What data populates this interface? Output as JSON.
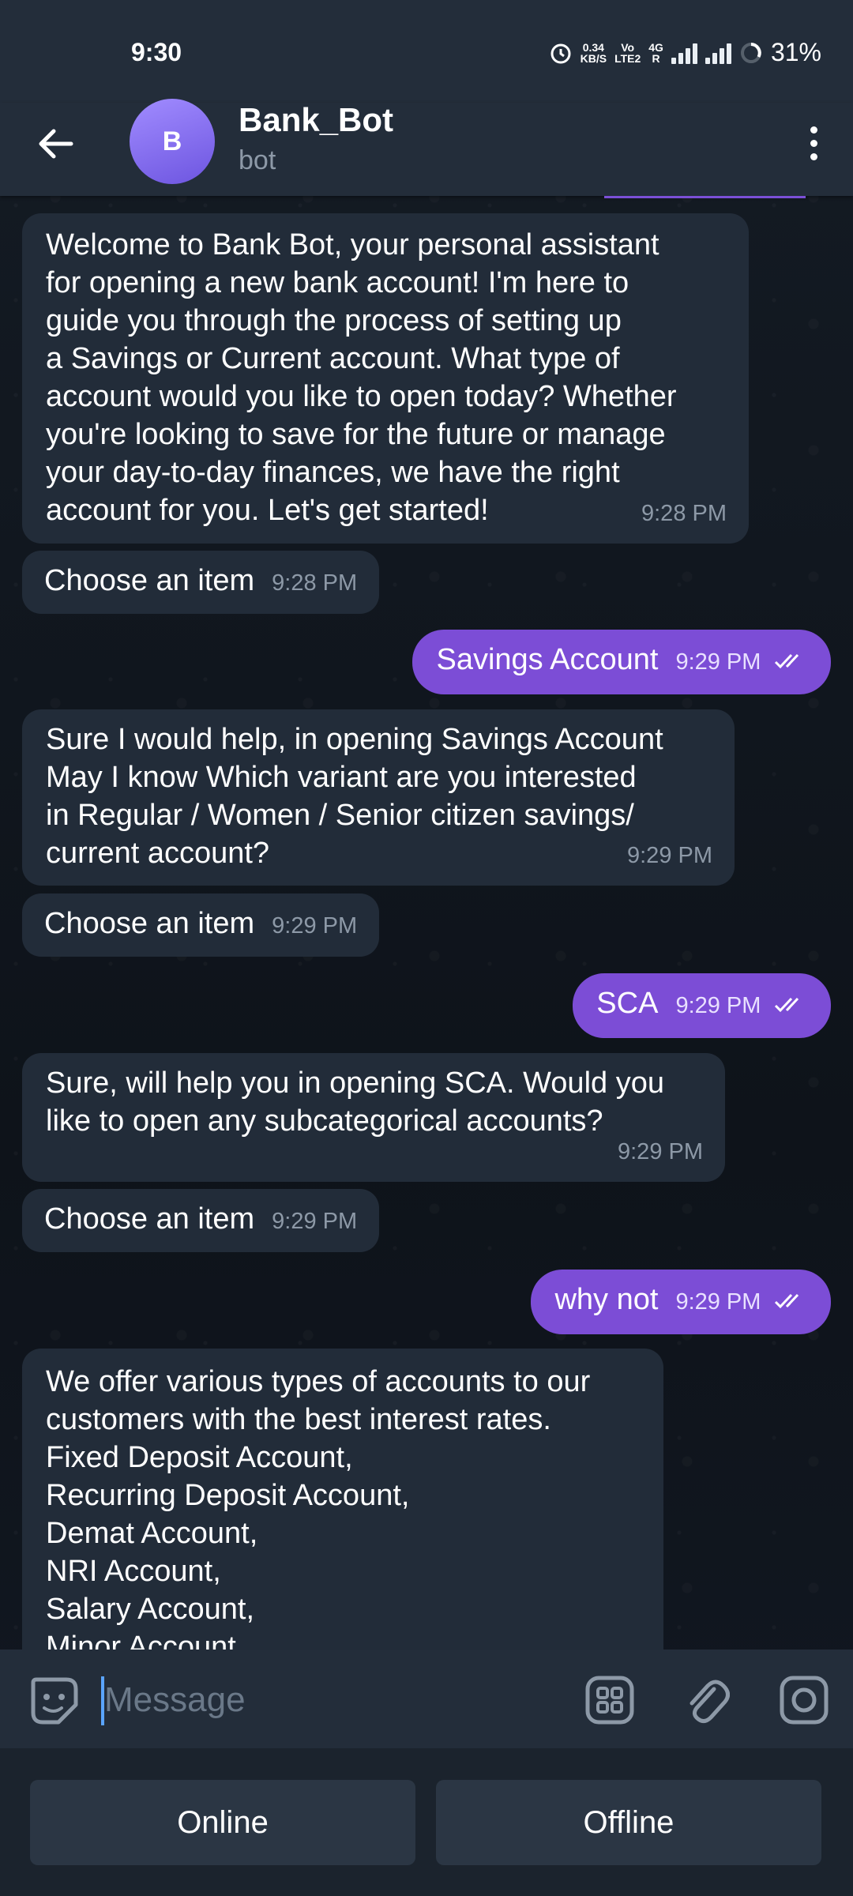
{
  "status_bar": {
    "time": "9:30",
    "speed_value": "0.34",
    "speed_unit": "KB/S",
    "volte": "Vo",
    "lte": "LTE2",
    "network": "4G",
    "roaming": "R",
    "battery": "31%"
  },
  "header": {
    "avatar_letter": "B",
    "title": "Bank_Bot",
    "subtitle": "bot"
  },
  "messages": [
    {
      "type": "in",
      "text": "Welcome to Bank Bot, your personal assistant\nfor opening a new bank account! I'm here to\nguide you through the process of setting up\na Savings or Current account. What type of\naccount would you like to open today? Whether\nyou're looking to save for the future or manage\nyour day-to-day finances, we have the right\naccount for you. Let's get started!",
      "time": "9:28 PM"
    },
    {
      "type": "in",
      "text": "Choose an item",
      "time": "9:28 PM"
    },
    {
      "type": "out",
      "text": "Savings Account",
      "time": "9:29 PM"
    },
    {
      "type": "in",
      "text": "Sure I would help, in opening Savings Account\nMay I know Which variant are you interested\nin Regular / Women / Senior citizen savings/\ncurrent account?",
      "time": "9:29 PM"
    },
    {
      "type": "in",
      "text": "Choose an item",
      "time": "9:29 PM"
    },
    {
      "type": "out",
      "text": "SCA",
      "time": "9:29 PM"
    },
    {
      "type": "in",
      "text": "Sure, will help you in opening SCA. Would you\nlike to open any subcategorical accounts?",
      "time": "9:29 PM"
    },
    {
      "type": "in",
      "text": "Choose an item",
      "time": "9:29 PM"
    },
    {
      "type": "out",
      "text": "why not",
      "time": "9:29 PM"
    },
    {
      "type": "in",
      "text": "We offer various types of accounts to our\ncustomers with the best interest rates.\nFixed Deposit Account,\nRecurring Deposit Account,\nDemat Account,\nNRI Account,\nSalary Account,\nMinor Account,",
      "time": ""
    }
  ],
  "input": {
    "placeholder": "Message"
  },
  "icons": {
    "back": "arrow-left-icon",
    "more": "more-vertical-icon",
    "emoji": "sticker-icon",
    "commands": "bot-menu-grid-icon",
    "attach": "paperclip-icon",
    "camera": "camera-icon"
  },
  "keyboard": {
    "buttons": [
      "Online",
      "Offline"
    ]
  },
  "colors": {
    "header_bg": "#232d3a",
    "incoming_bubble": "#222c39",
    "outgoing_bubble": "#7c4dd6",
    "accent_cursor": "#5aa4ff"
  }
}
